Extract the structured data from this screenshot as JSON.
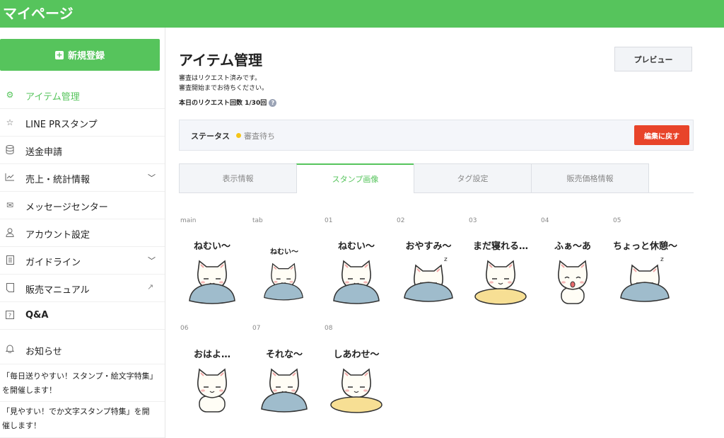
{
  "header": {
    "title": "マイページ"
  },
  "sidebar": {
    "new_button": "新規登録",
    "items": [
      {
        "label": "アイテム管理",
        "icon": "gear-icon",
        "active": true
      },
      {
        "label": "LINE PRスタンプ",
        "icon": "star-icon"
      },
      {
        "label": "送金申請",
        "icon": "database-icon"
      },
      {
        "label": "売上・統計情報",
        "icon": "chart-icon",
        "expandable": true
      },
      {
        "label": "メッセージセンター",
        "icon": "mail-icon"
      },
      {
        "label": "アカウント設定",
        "icon": "user-icon"
      },
      {
        "label": "ガイドライン",
        "icon": "document-icon",
        "expandable": true
      },
      {
        "label": "販売マニュアル",
        "icon": "book-icon",
        "external": true
      },
      {
        "label": "Q&A",
        "icon": "question-icon"
      }
    ],
    "notice_label": "お知らせ",
    "news": [
      {
        "line1": "「毎日送りやすい！スタンプ・絵文字特集」",
        "line2": "を開催します！"
      },
      {
        "line1": "「見やすい！でか文字スタンプ特集」を開",
        "line2": "催します！"
      }
    ]
  },
  "main": {
    "title": "アイテム管理",
    "note1": "審査はリクエスト済みです。",
    "note2": "審査開始までお待ちください。",
    "request_count": "本日のリクエスト回数 1/30回",
    "preview_button": "プレビュー",
    "status_label": "ステータス",
    "status_value": "審査待ち",
    "status_color": "#f5c518",
    "back_button": "編集に戻す",
    "tabs": [
      "表示情報",
      "スタンプ画像",
      "タグ設定",
      "販売価格情報"
    ],
    "active_tab": 1
  },
  "stickers": [
    {
      "id": "main",
      "caption": "ねむい～",
      "pose": "blanket"
    },
    {
      "id": "tab",
      "caption": "ねむい～",
      "pose": "blanket"
    },
    {
      "id": "01",
      "caption": "ねむい～",
      "pose": "blanket"
    },
    {
      "id": "02",
      "caption": "おやすみ～",
      "pose": "sleep"
    },
    {
      "id": "03",
      "caption": "まだ寝れる…",
      "pose": "cushion"
    },
    {
      "id": "04",
      "caption": "ふぁ～あ",
      "pose": "yawn"
    },
    {
      "id": "05",
      "caption": "ちょっと休憩～",
      "pose": "sleep"
    },
    {
      "id": "06",
      "caption": "おはよ…",
      "pose": "plain"
    },
    {
      "id": "07",
      "caption": "それな～",
      "pose": "blanket"
    },
    {
      "id": "08",
      "caption": "しあわせ～",
      "pose": "cushion"
    }
  ],
  "colors": {
    "brand_green": "#56c45c",
    "blanket_blue": "#9fbccc",
    "cushion_yellow": "#f7df94",
    "danger_red": "#e8442a"
  }
}
